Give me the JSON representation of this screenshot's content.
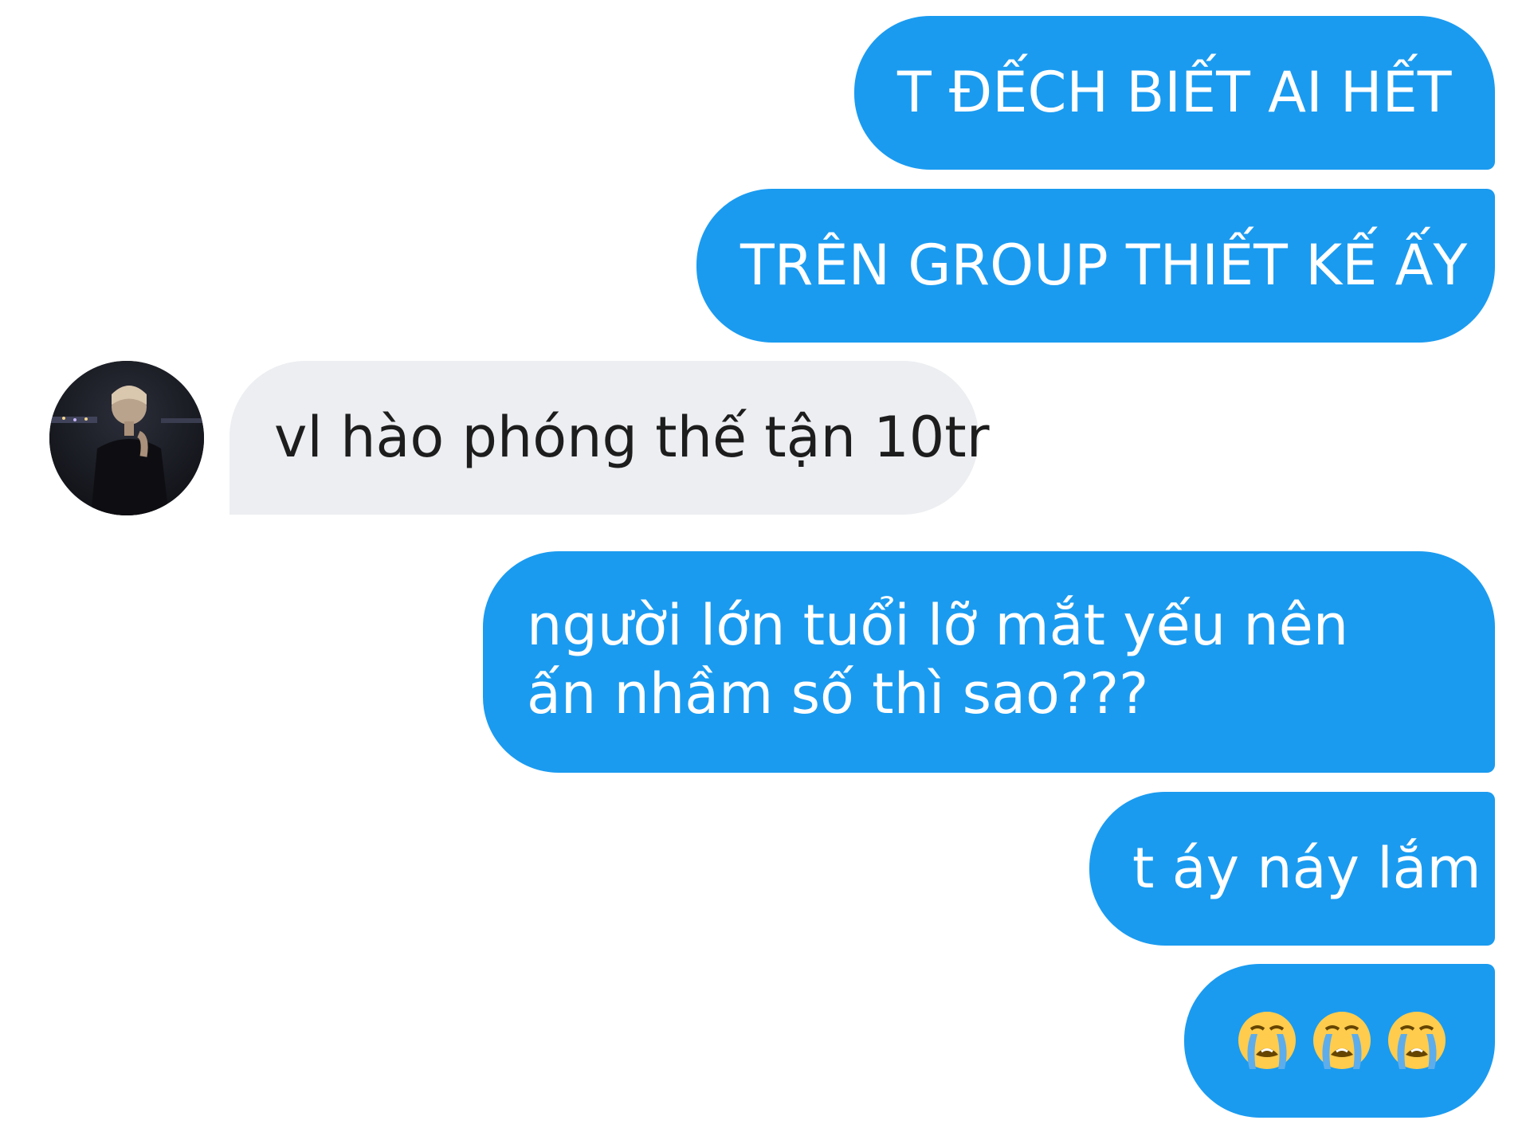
{
  "messages": [
    {
      "id": "m1",
      "side": "sent",
      "text": "T ĐẾCH BIẾT AI HẾT"
    },
    {
      "id": "m2",
      "side": "sent",
      "text": "TRÊN GROUP THIẾT KẾ ẤY"
    },
    {
      "id": "m3",
      "side": "received",
      "text": "vl hào phóng thế tận 10tr"
    },
    {
      "id": "m4",
      "side": "sent",
      "text": "người lớn tuổi lỡ mắt yếu nên ấn nhầm số thì sao???"
    },
    {
      "id": "m5",
      "side": "sent",
      "text": "t áy náy lắm"
    },
    {
      "id": "m6",
      "side": "sent",
      "emoji": [
        "loudly-crying-face",
        "loudly-crying-face",
        "loudly-crying-face"
      ]
    }
  ],
  "colors": {
    "sent_bubble": "#1a9bf0",
    "received_bubble": "#eceef1",
    "sent_text": "#ffffff",
    "received_text": "#1d1d1d"
  },
  "avatar": {
    "icon": "user-photo-avatar"
  }
}
